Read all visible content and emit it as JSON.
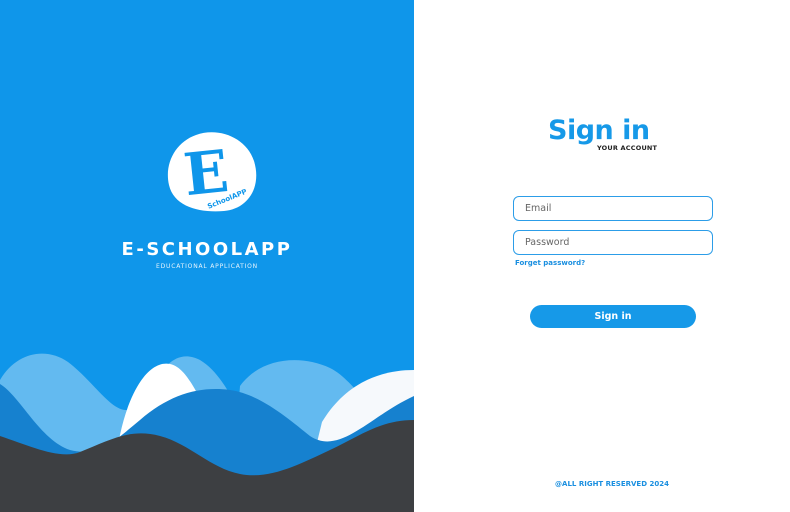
{
  "brand": {
    "logo_letter": "E",
    "logo_badge": "SchoolAPP",
    "name": "E-SCHOOLAPP",
    "tagline": "EDUCATIONAL APPLICATION"
  },
  "login": {
    "title": "Sign in",
    "subtitle": "YOUR ACCOUNT",
    "email_placeholder": "Email",
    "email_value": "",
    "password_placeholder": "Password",
    "password_value": "",
    "forgot_label": "Forget password?",
    "submit_label": "Sign in"
  },
  "footer": {
    "copyright": "@ALL RIGHT RESERVED 2024"
  },
  "colors": {
    "primary": "#0f96ea",
    "accent": "#1699e8",
    "wave_light": "#63baf0",
    "wave_mid": "#1681cf",
    "wave_white": "#ffffff",
    "wave_dark": "#3d3f42"
  }
}
